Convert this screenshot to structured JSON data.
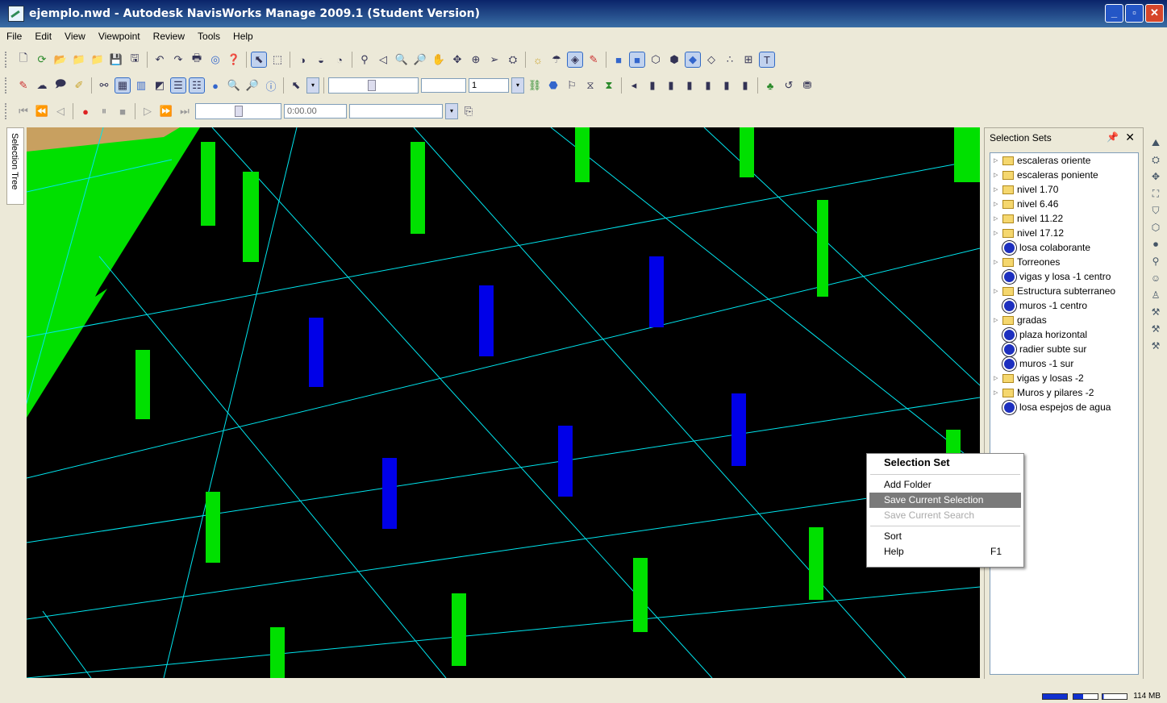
{
  "window": {
    "title": "ejemplo.nwd - Autodesk NavisWorks Manage 2009.1 (Student Version)",
    "buttons": [
      "_",
      "▫",
      "✕"
    ]
  },
  "menu": [
    "File",
    "Edit",
    "View",
    "Viewpoint",
    "Review",
    "Tools",
    "Help"
  ],
  "toolbar": {
    "zoom_value": "1",
    "time_value": "0:00.00"
  },
  "side_tab": {
    "label": "Selection Tree"
  },
  "selection_sets": {
    "title": "Selection Sets",
    "items": [
      {
        "label": "escaleras oriente",
        "type": "folder"
      },
      {
        "label": "escaleras poniente",
        "type": "folder"
      },
      {
        "label": "nivel 1.70",
        "type": "folder"
      },
      {
        "label": "nivel 6.46",
        "type": "folder"
      },
      {
        "label": "nivel 11.22",
        "type": "folder"
      },
      {
        "label": "nivel 17.12",
        "type": "folder"
      },
      {
        "label": "losa colaborante",
        "type": "set"
      },
      {
        "label": "Torreones",
        "type": "folder"
      },
      {
        "label": "vigas y losa -1 centro",
        "type": "set"
      },
      {
        "label": "Estructura subterraneo",
        "type": "folder"
      },
      {
        "label": "muros -1 centro",
        "type": "set"
      },
      {
        "label": "gradas",
        "type": "folder"
      },
      {
        "label": "plaza horizontal",
        "type": "set"
      },
      {
        "label": "radier subte sur",
        "type": "set"
      },
      {
        "label": "muros -1 sur",
        "type": "set"
      },
      {
        "label": "vigas y losas -2",
        "type": "folder"
      },
      {
        "label": "Muros y pilares -2",
        "type": "folder"
      },
      {
        "label": "losa espejos de agua",
        "type": "set"
      }
    ]
  },
  "context_menu": {
    "title": "Selection Set",
    "items": {
      "add_folder": "Add Folder",
      "save_current_selection": "Save Current Selection",
      "save_current_search": "Save Current Search",
      "sort": "Sort",
      "help": "Help",
      "help_key": "F1"
    }
  },
  "status": {
    "memory": "114 MB"
  }
}
